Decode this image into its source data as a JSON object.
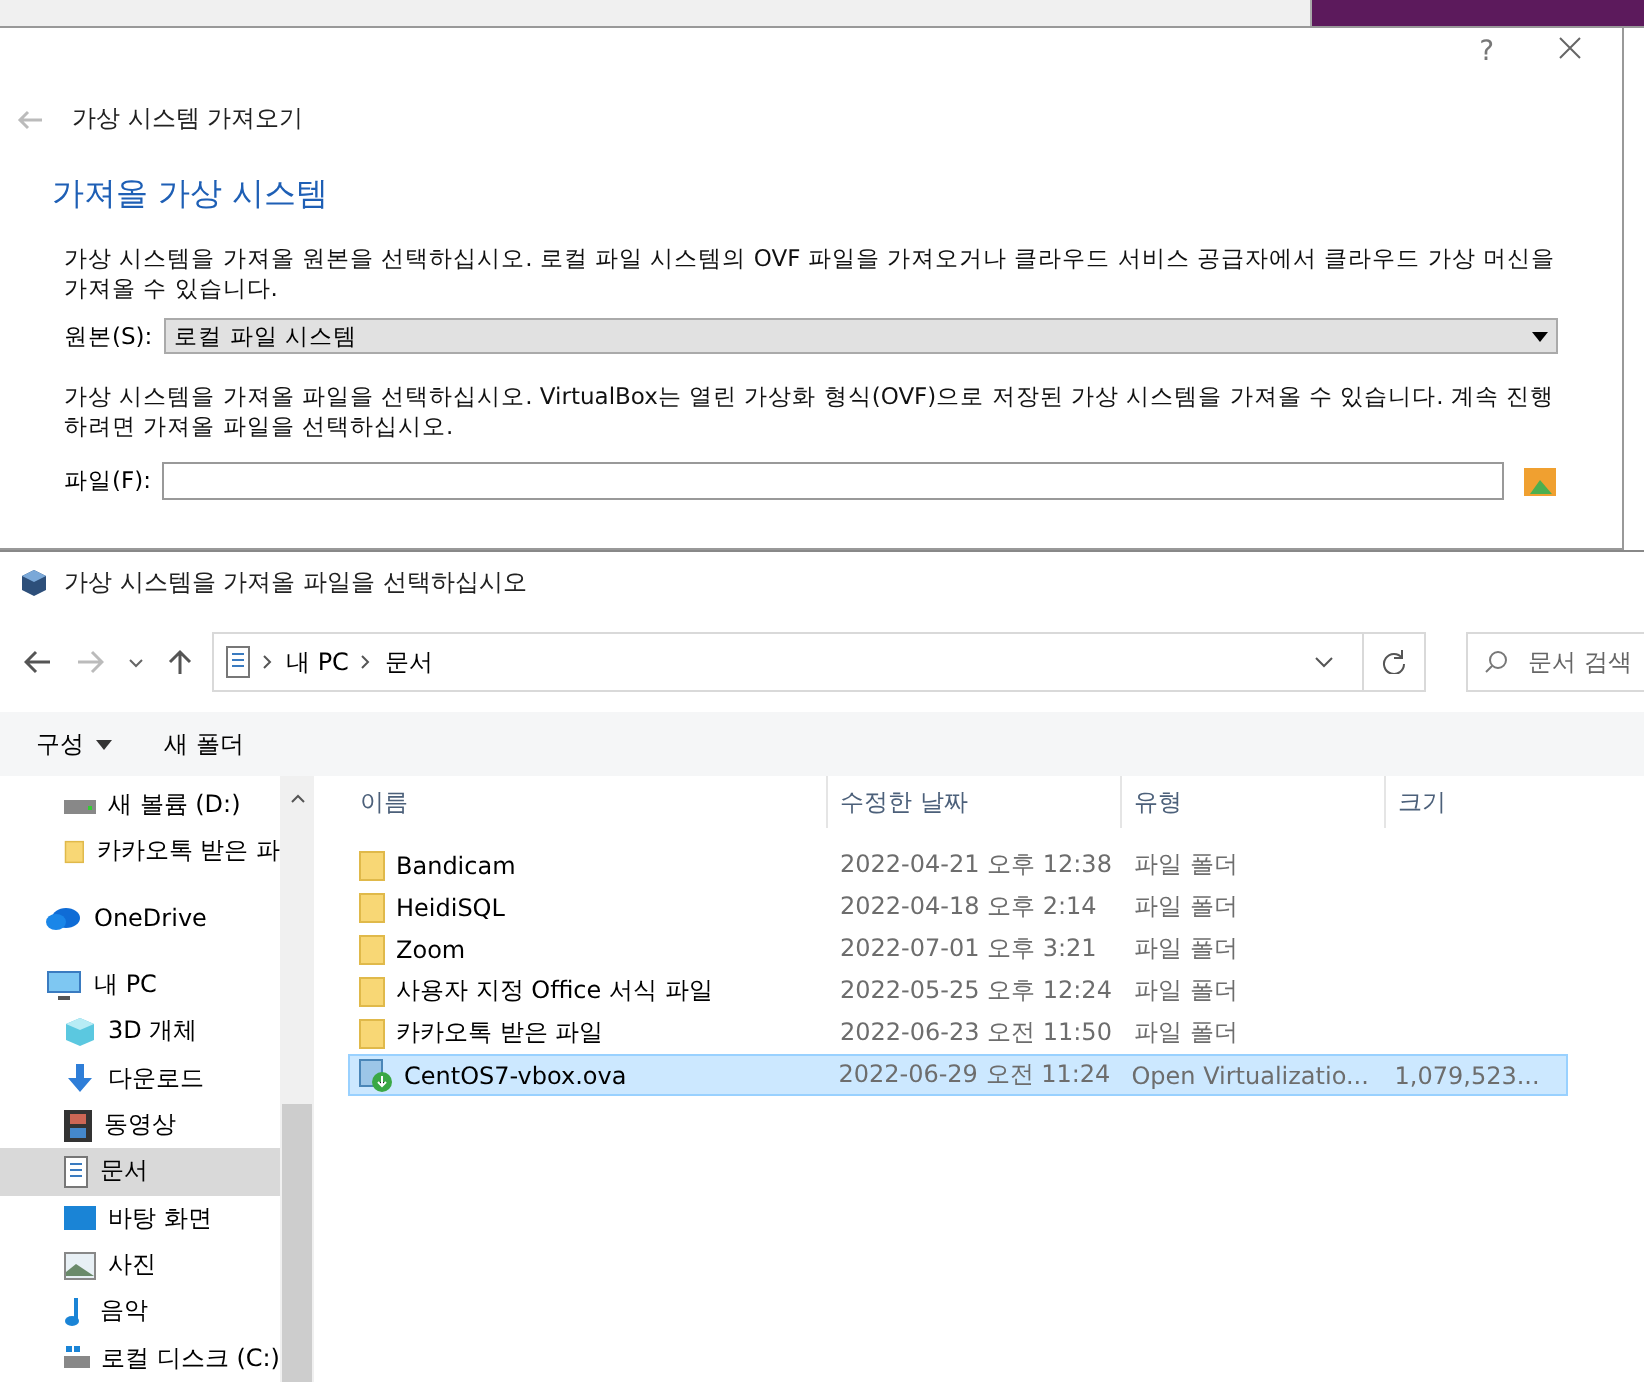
{
  "wizard": {
    "title": "가상 시스템 가져오기",
    "heading": "가져올 가상 시스템",
    "help_button": "?",
    "intro": "가상 시스템을 가져올 원본을 선택하십시오. 로컬 파일 시스템의 OVF 파일을 가져오거나 클라우드 서비스 공급자에서 클라우드 가상 머신을 가져올 수 있습니다.",
    "source_label": "원본(S):",
    "source_value": "로컬 파일 시스템",
    "file_intro": "가상 시스템을 가져올 파일을 선택하십시오. VirtualBox는 열린 가상화 형식(OVF)으로 저장된 가상 시스템을 가져올 수 있습니다. 계속 진행하려면 가져올 파일을 선택하십시오.",
    "file_label": "파일(F):"
  },
  "file_dialog": {
    "title": "가상 시스템을 가져올 파일을 선택하십시오",
    "breadcrumb": [
      "내 PC",
      "문서"
    ],
    "search": {
      "placeholder": "문서 검색"
    },
    "toolbar": [
      "구성",
      "새 폴더"
    ],
    "sidebar": {
      "sections": [
        {
          "items": [
            {
              "label": "새 볼륨 (D:)",
              "kind": "drive",
              "selected": false
            },
            {
              "label": "카카오톡 받은 파",
              "kind": "folder",
              "selected": false
            }
          ]
        },
        {
          "label": "OneDrive",
          "kind": "cloud"
        },
        {
          "label": "내 PC",
          "kind": "pc",
          "items": [
            {
              "label": "3D 개체",
              "kind": "cube",
              "selected": false
            },
            {
              "label": "다운로드",
              "kind": "download",
              "selected": false
            },
            {
              "label": "동영상",
              "kind": "video",
              "selected": false
            },
            {
              "label": "문서",
              "kind": "document",
              "selected": true
            },
            {
              "label": "바탕 화면",
              "kind": "desktop",
              "selected": false
            },
            {
              "label": "사진",
              "kind": "picture",
              "selected": false
            },
            {
              "label": "음악",
              "kind": "music",
              "selected": false
            },
            {
              "label": "로컬 디스크 (C:)",
              "kind": "disk",
              "selected": false
            }
          ]
        }
      ]
    },
    "table": {
      "columns": [
        "이름",
        "수정한 날짜",
        "유형",
        "크기"
      ],
      "rows": [
        {
          "kind": "folder",
          "name": "Bandicam",
          "modified": "2022-04-21 오후 12:38",
          "type": "파일 폴더",
          "selected": false
        },
        {
          "kind": "folder",
          "name": "HeidiSQL",
          "modified": "2022-04-18 오후 2:14",
          "type": "파일 폴더",
          "selected": false
        },
        {
          "kind": "folder",
          "name": "Zoom",
          "modified": "2022-07-01 오후 3:21",
          "type": "파일 폴더",
          "selected": false
        },
        {
          "kind": "folder",
          "name": "사용자 지정 Office 서식 파일",
          "modified": "2022-05-25 오후 12:24",
          "type": "파일 폴더",
          "selected": false
        },
        {
          "kind": "folder",
          "name": "카카오톡 받은 파일",
          "modified": "2022-06-23 오전 11:50",
          "type": "파일 폴더",
          "selected": false
        },
        {
          "kind": "ova",
          "name": "CentOS7-vbox.ova",
          "modified": "2022-06-29 오전 11:24",
          "type": "Open Virtualizatio...",
          "size": "1,079,523...",
          "selected": true
        }
      ]
    }
  }
}
